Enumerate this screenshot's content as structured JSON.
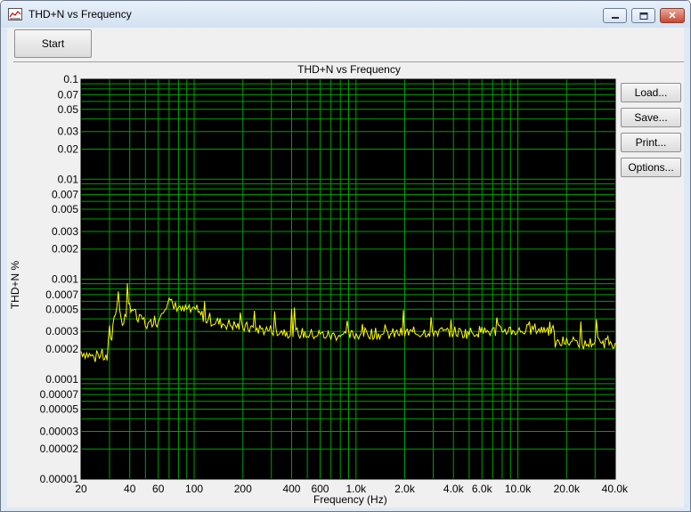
{
  "window": {
    "title": "THD+N vs Frequency",
    "close_glyph": "✕"
  },
  "toolbar": {
    "start_label": "Start"
  },
  "side_buttons": {
    "load": "Load...",
    "save": "Save...",
    "print": "Print...",
    "options": "Options..."
  },
  "icons": {
    "app": "graph-window-icon",
    "minimize": "minimize-icon",
    "maximize": "maximize-icon",
    "close": "close-icon"
  },
  "chart_data": {
    "type": "line",
    "title": "THD+N vs Frequency",
    "xlabel": "Frequency (Hz)",
    "ylabel": "THD+N %",
    "x_scale": "log",
    "y_scale": "log",
    "xlim": [
      20,
      40000
    ],
    "ylim": [
      1e-05,
      0.1
    ],
    "grid": true,
    "background": "#000000",
    "grid_color": "#00a000",
    "trace_color": "#ffff00",
    "x_tick_labels": [
      {
        "v": 20,
        "t": "20"
      },
      {
        "v": 40,
        "t": "40"
      },
      {
        "v": 60,
        "t": "60"
      },
      {
        "v": 100,
        "t": "100"
      },
      {
        "v": 200,
        "t": "200"
      },
      {
        "v": 400,
        "t": "400"
      },
      {
        "v": 600,
        "t": "600"
      },
      {
        "v": 1000,
        "t": "1.0k"
      },
      {
        "v": 2000,
        "t": "2.0k"
      },
      {
        "v": 4000,
        "t": "4.0k"
      },
      {
        "v": 6000,
        "t": "6.0k"
      },
      {
        "v": 10000,
        "t": "10.0k"
      },
      {
        "v": 20000,
        "t": "20.0k"
      },
      {
        "v": 40000,
        "t": "40.0k"
      }
    ],
    "y_tick_labels": [
      {
        "v": 0.1,
        "t": "0.1"
      },
      {
        "v": 0.07,
        "t": "0.07"
      },
      {
        "v": 0.05,
        "t": "0.05"
      },
      {
        "v": 0.03,
        "t": "0.03"
      },
      {
        "v": 0.02,
        "t": "0.02"
      },
      {
        "v": 0.01,
        "t": "0.01"
      },
      {
        "v": 0.007,
        "t": "0.007"
      },
      {
        "v": 0.005,
        "t": "0.005"
      },
      {
        "v": 0.003,
        "t": "0.003"
      },
      {
        "v": 0.002,
        "t": "0.002"
      },
      {
        "v": 0.001,
        "t": "0.001"
      },
      {
        "v": 0.0007,
        "t": "0.0007"
      },
      {
        "v": 0.0005,
        "t": "0.0005"
      },
      {
        "v": 0.0003,
        "t": "0.0003"
      },
      {
        "v": 0.0002,
        "t": "0.0002"
      },
      {
        "v": 0.0001,
        "t": "0.0001"
      },
      {
        "v": 7e-05,
        "t": "0.00007"
      },
      {
        "v": 5e-05,
        "t": "0.00005"
      },
      {
        "v": 3e-05,
        "t": "0.00003"
      },
      {
        "v": 2e-05,
        "t": "0.00002"
      },
      {
        "v": 1e-05,
        "t": "0.00001"
      }
    ],
    "series": [
      {
        "x": [
          20,
          23,
          25,
          27,
          29,
          30,
          31,
          32,
          34,
          36,
          38,
          40,
          42,
          45,
          48,
          50,
          53,
          56,
          60,
          63,
          66,
          70,
          75,
          80,
          85,
          90,
          100,
          110,
          120,
          130,
          150,
          170,
          200,
          240,
          280,
          320,
          360,
          400,
          450,
          500,
          560,
          600,
          700,
          800,
          900,
          1000,
          1200,
          1400,
          1600,
          2000,
          2400,
          2800,
          3200,
          3600,
          4000,
          4500,
          5000,
          5600,
          6000,
          7000,
          8000,
          9000,
          10000,
          11000,
          12000,
          13000,
          14000,
          15000,
          15500,
          16000,
          16500,
          17000,
          18000,
          19000,
          20000,
          22000,
          24000,
          26000,
          28000,
          30000,
          33000,
          36000,
          40000
        ],
        "y": [
          0.00019,
          0.00017,
          0.00016,
          0.00017,
          0.00016,
          0.00031,
          0.00025,
          0.00045,
          0.0006,
          0.00035,
          0.00045,
          0.00055,
          0.0005,
          0.00038,
          0.0004,
          0.00036,
          0.00034,
          0.0004,
          0.00037,
          0.0005,
          0.00055,
          0.0006,
          0.00052,
          0.00055,
          0.00048,
          0.0005,
          0.00046,
          0.00044,
          0.0004,
          0.00038,
          0.00036,
          0.00035,
          0.00033,
          0.00032,
          0.00031,
          0.00031,
          0.0003,
          0.00029,
          0.00029,
          0.00028,
          0.00028,
          0.00028,
          0.00027,
          0.00028,
          0.00027,
          0.00028,
          0.00029,
          0.00028,
          0.00028,
          0.00029,
          0.00029,
          0.0003,
          0.0003,
          0.00029,
          0.0003,
          0.00029,
          0.00029,
          0.0003,
          0.0003,
          0.0003,
          0.00031,
          0.00031,
          0.0003,
          0.00031,
          0.00031,
          0.00032,
          0.00031,
          0.00032,
          0.00031,
          0.00031,
          0.0003,
          0.00023,
          0.00022,
          0.00024,
          0.00023,
          0.00024,
          0.00023,
          0.00022,
          0.00023,
          0.00024,
          0.00023,
          0.00024,
          0.00023
        ]
      }
    ]
  }
}
